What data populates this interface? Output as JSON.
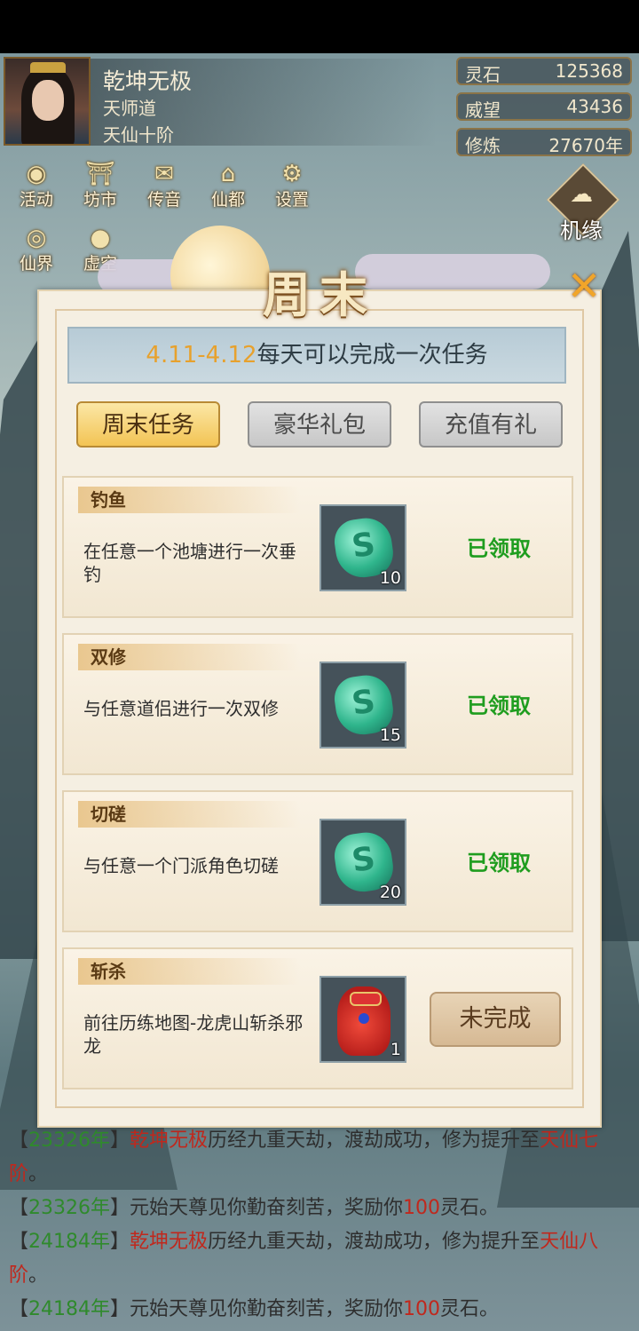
{
  "profile": {
    "name": "乾坤无极",
    "sect": "天师道",
    "rank": "天仙十阶"
  },
  "stats": [
    {
      "label": "灵石",
      "value": "125368"
    },
    {
      "label": "威望",
      "value": "43436"
    },
    {
      "label": "修炼",
      "value": "27670年"
    }
  ],
  "menu": [
    {
      "label": "活动",
      "icon": "coin-icon"
    },
    {
      "label": "坊市",
      "icon": "shop-icon"
    },
    {
      "label": "传音",
      "icon": "envelope-icon"
    },
    {
      "label": "仙都",
      "icon": "pavilion-icon"
    },
    {
      "label": "设置",
      "icon": "gear-icon"
    },
    {
      "label": "仙界",
      "icon": "ring-icon"
    },
    {
      "label": "虚空",
      "icon": "planet-icon"
    }
  ],
  "jiyuan": {
    "label": "机缘"
  },
  "dialog": {
    "title": "周末",
    "banner_date": "4.11-4.12",
    "banner_text": "每天可以完成一次任务",
    "tabs": [
      {
        "label": "周末任务",
        "active": true
      },
      {
        "label": "豪华礼包",
        "active": false
      },
      {
        "label": "充值有礼",
        "active": false
      }
    ],
    "tasks": [
      {
        "name": "钓鱼",
        "desc": "在任意一个池塘进行一次垂钓",
        "reward": "spirit-stone-icon",
        "count": "10",
        "status": "已领取"
      },
      {
        "name": "双修",
        "desc": "与任意道侣进行一次双修",
        "reward": "spirit-stone-icon",
        "count": "15",
        "status": "已领取"
      },
      {
        "name": "切磋",
        "desc": "与任意一个门派角色切磋",
        "reward": "spirit-stone-icon",
        "count": "20",
        "status": "已领取"
      },
      {
        "name": "斩杀",
        "desc": "前往历练地图-龙虎山斩杀邪龙",
        "reward": "red-pouch-icon",
        "count": "1",
        "status": "未完成"
      }
    ]
  },
  "log": [
    {
      "open": "【",
      "year": "23326年",
      "close": "】",
      "name": "乾坤无极",
      "text": "历经九重天劫，渡劫成功，修为提升至",
      "result": "天仙七阶",
      "tail": "。"
    },
    {
      "open": "【",
      "year": "23326年",
      "close": "】",
      "text": "元始天尊见你勤奋刻苦，奖励你",
      "amount": "100",
      "unit": "灵石。"
    },
    {
      "open": "【",
      "year": "24184年",
      "close": "】",
      "name": "乾坤无极",
      "text": "历经九重天劫，渡劫成功，修为提升至",
      "result": "天仙八阶",
      "tail": "。"
    },
    {
      "open": "【",
      "year": "24184年",
      "close": "】",
      "text": "元始天尊见你勤奋刻苦，奖励你",
      "amount": "100",
      "unit": "灵石。"
    }
  ]
}
